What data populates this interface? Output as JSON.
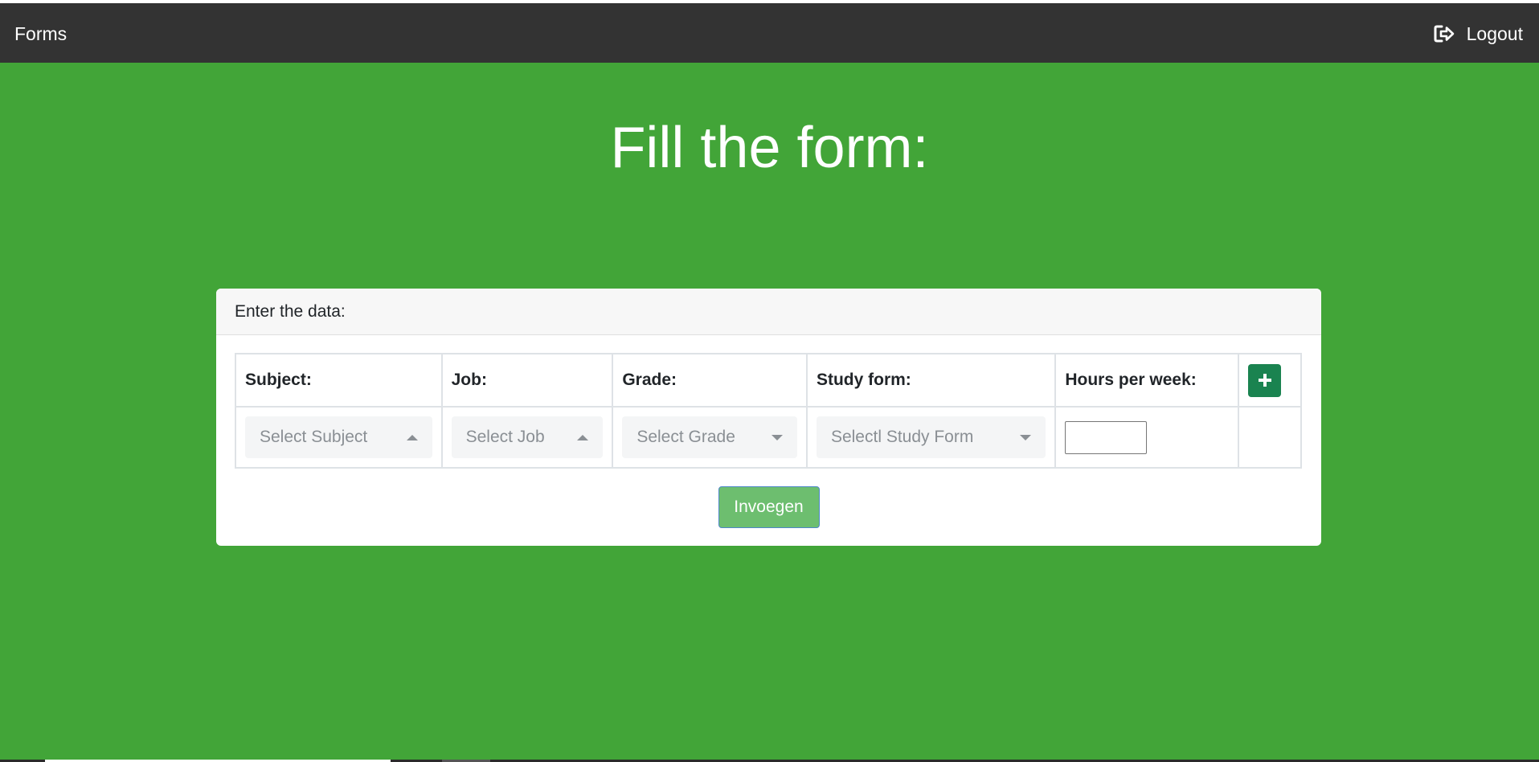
{
  "navbar": {
    "brand": "Forms",
    "logout_label": "Logout",
    "logout_icon": "sign-out-icon",
    "background": "#333333"
  },
  "page": {
    "title": "Fill the form:",
    "background": "#42a538"
  },
  "card": {
    "header": "Enter the data:",
    "columns": [
      "Subject:",
      "Job:",
      "Grade:",
      "Study form:",
      "Hours per week:"
    ],
    "add_icon": "plus-icon",
    "add_button_color": "#1a8350",
    "row": {
      "subject_placeholder": "Select Subject",
      "job_placeholder": "Select Job",
      "grade_placeholder": "Select Grade",
      "study_form_placeholder": "Selectl Study Form",
      "hours_value": ""
    },
    "submit_label": "Invoegen",
    "submit_color": "#6dbe6f"
  }
}
